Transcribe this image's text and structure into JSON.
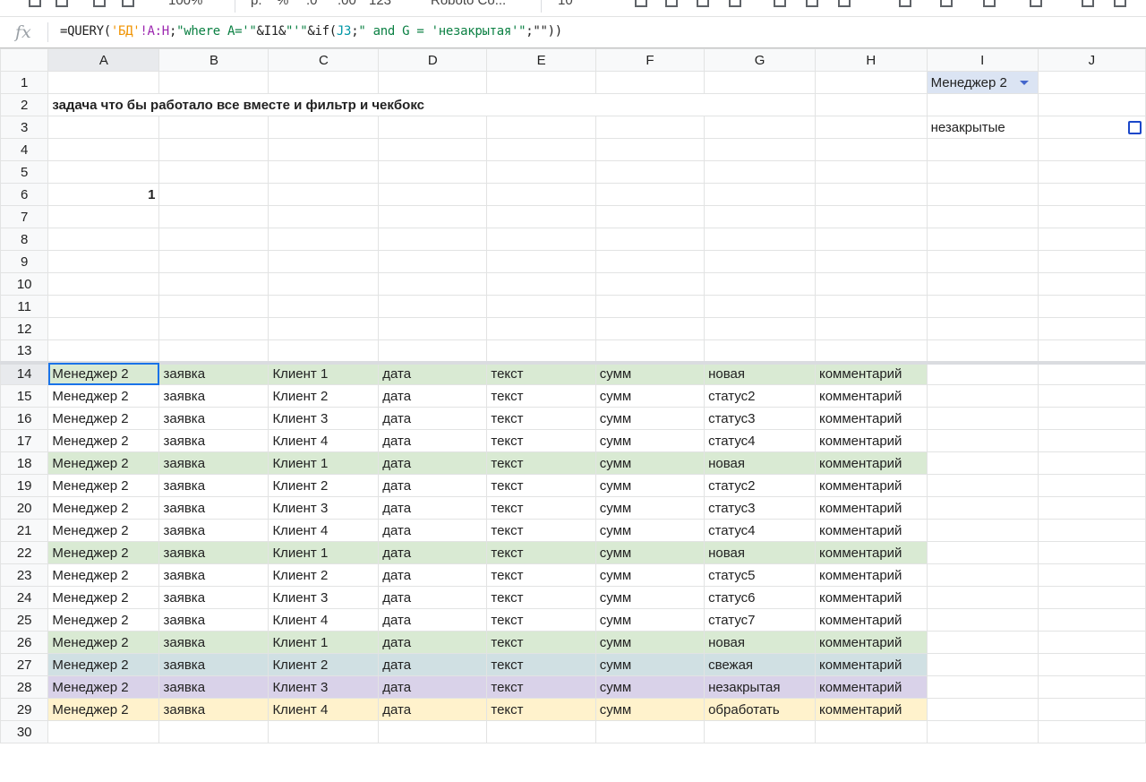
{
  "toolbar": {
    "items": [
      "100%",
      "р.",
      "%",
      ".0",
      ".00",
      "123",
      "Roboto Co...",
      "10"
    ]
  },
  "formula_bar": {
    "fx_label": "fx",
    "parts": [
      {
        "text": "=QUERY(",
        "kind": "plain"
      },
      {
        "text": "'БД'",
        "kind": "ref1"
      },
      {
        "text": "!A:H",
        "kind": "ref2"
      },
      {
        "text": ";",
        "kind": "plain"
      },
      {
        "text": "\"where A='\"",
        "kind": "str"
      },
      {
        "text": "&I1&",
        "kind": "plain"
      },
      {
        "text": "\"'\"",
        "kind": "str"
      },
      {
        "text": "&if(",
        "kind": "plain"
      },
      {
        "text": "J3",
        "kind": "ref3"
      },
      {
        "text": ";",
        "kind": "plain"
      },
      {
        "text": "\" and G = 'незакрытая'\"",
        "kind": "str"
      },
      {
        "text": ";\"\"))",
        "kind": "plain"
      }
    ]
  },
  "columns": [
    "A",
    "B",
    "C",
    "D",
    "E",
    "F",
    "G",
    "H",
    "I",
    "J"
  ],
  "header_cells": {
    "i1_dropdown": "Менеджер 2",
    "a2_title": "задача что бы работало все вместе и фильтр и чекбокс",
    "i3_label": "незакрытые",
    "a6_value": "1",
    "j3_checkbox_checked": false
  },
  "empty_rows": [
    4,
    5,
    7,
    8,
    9,
    10,
    11,
    12,
    13
  ],
  "data_rows": [
    {
      "row": 14,
      "cells": [
        "Менеджер 2",
        "заявка",
        "Клиент 1",
        "дата",
        "текст",
        "сумм",
        "новая",
        "комментарий"
      ],
      "highlight": "green"
    },
    {
      "row": 15,
      "cells": [
        "Менеджер 2",
        "заявка",
        "Клиент 2",
        "дата",
        "текст",
        "сумм",
        "статус2",
        "комментарий"
      ],
      "highlight": "none"
    },
    {
      "row": 16,
      "cells": [
        "Менеджер 2",
        "заявка",
        "Клиент 3",
        "дата",
        "текст",
        "сумм",
        "статус3",
        "комментарий"
      ],
      "highlight": "none"
    },
    {
      "row": 17,
      "cells": [
        "Менеджер 2",
        "заявка",
        "Клиент 4",
        "дата",
        "текст",
        "сумм",
        "статус4",
        "комментарий"
      ],
      "highlight": "none"
    },
    {
      "row": 18,
      "cells": [
        "Менеджер 2",
        "заявка",
        "Клиент 1",
        "дата",
        "текст",
        "сумм",
        "новая",
        "комментарий"
      ],
      "highlight": "green"
    },
    {
      "row": 19,
      "cells": [
        "Менеджер 2",
        "заявка",
        "Клиент 2",
        "дата",
        "текст",
        "сумм",
        "статус2",
        "комментарий"
      ],
      "highlight": "none"
    },
    {
      "row": 20,
      "cells": [
        "Менеджер 2",
        "заявка",
        "Клиент 3",
        "дата",
        "текст",
        "сумм",
        "статус3",
        "комментарий"
      ],
      "highlight": "none"
    },
    {
      "row": 21,
      "cells": [
        "Менеджер 2",
        "заявка",
        "Клиент 4",
        "дата",
        "текст",
        "сумм",
        "статус4",
        "комментарий"
      ],
      "highlight": "none"
    },
    {
      "row": 22,
      "cells": [
        "Менеджер 2",
        "заявка",
        "Клиент 1",
        "дата",
        "текст",
        "сумм",
        "новая",
        "комментарий"
      ],
      "highlight": "green"
    },
    {
      "row": 23,
      "cells": [
        "Менеджер 2",
        "заявка",
        "Клиент 2",
        "дата",
        "текст",
        "сумм",
        "статус5",
        "комментарий"
      ],
      "highlight": "none"
    },
    {
      "row": 24,
      "cells": [
        "Менеджер 2",
        "заявка",
        "Клиент 3",
        "дата",
        "текст",
        "сумм",
        "статус6",
        "комментарий"
      ],
      "highlight": "none"
    },
    {
      "row": 25,
      "cells": [
        "Менеджер 2",
        "заявка",
        "Клиент 4",
        "дата",
        "текст",
        "сумм",
        "статус7",
        "комментарий"
      ],
      "highlight": "none"
    },
    {
      "row": 26,
      "cells": [
        "Менеджер 2",
        "заявка",
        "Клиент 1",
        "дата",
        "текст",
        "сумм",
        "новая",
        "комментарий"
      ],
      "highlight": "green"
    },
    {
      "row": 27,
      "cells": [
        "Менеджер 2",
        "заявка",
        "Клиент 2",
        "дата",
        "текст",
        "сумм",
        "свежая",
        "комментарий"
      ],
      "highlight": "bluegray"
    },
    {
      "row": 28,
      "cells": [
        "Менеджер 2",
        "заявка",
        "Клиент 3",
        "дата",
        "текст",
        "сумм",
        "незакрытая",
        "комментарий"
      ],
      "highlight": "purple"
    },
    {
      "row": 29,
      "cells": [
        "Менеджер 2",
        "заявка",
        "Клиент 4",
        "дата",
        "текст",
        "сумм",
        "обработать",
        "комментарий"
      ],
      "highlight": "yellow"
    }
  ],
  "last_row_label": "30",
  "highlight_colors": {
    "green": "#d9ead3",
    "bluegray": "#d0e0e3",
    "purple": "#d9d2e9",
    "yellow": "#fff2cc",
    "none": "#ffffff"
  },
  "active_cell": "A14"
}
